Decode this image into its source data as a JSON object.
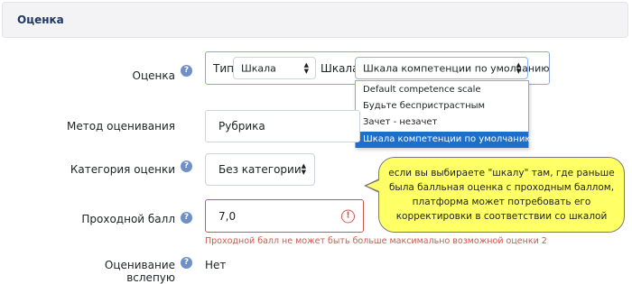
{
  "section": {
    "title": "Оценка"
  },
  "fields": {
    "grade_label": "Оценка",
    "type_label": "Тип",
    "type_value": "Шкала",
    "scale_label": "Шкала",
    "scale_value": "Шкала компетенции по умолчанию",
    "method_label": "Метод оценивания",
    "method_value": "Рубрика",
    "category_label": "Категория оценки",
    "category_value": "Без категории",
    "pass_label": "Проходной балл",
    "pass_value": "7,0",
    "pass_error": "Проходной балл не может быть больше максимально возможной оценки 2",
    "blind_label": "Оценивание вслепую",
    "blind_value": "Нет"
  },
  "scale_options": [
    "Default competence scale",
    "Будьте беспристрастным",
    "Зачет - незачет",
    "Шкала компетенции по умолчанию"
  ],
  "callout": {
    "text": "если вы выбираете \"шкалу\" там, где раньше была балльная оценка с проходным баллом, платформа может потребовать его корректировки в соответствии со шкалой"
  },
  "icons": {
    "help": "question-circle-icon",
    "caret": "sort-caret-icon",
    "error": "exclamation-circle-icon"
  },
  "colors": {
    "accent": "#1e6fc7",
    "error": "#d9534f",
    "callout_bg": "#ffff66",
    "help_icon": "#6f8fc7"
  }
}
